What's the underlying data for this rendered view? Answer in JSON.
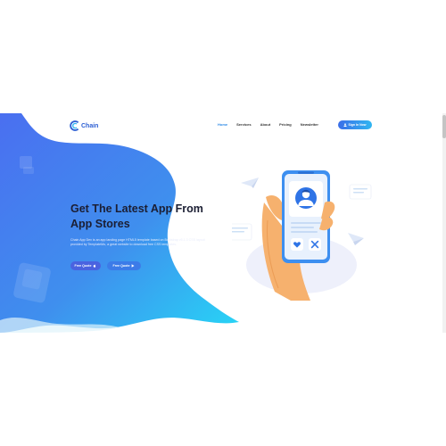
{
  "brand": {
    "name": "Chain"
  },
  "nav": {
    "links": [
      "Home",
      "Services",
      "About",
      "Pricing",
      "Newsletter"
    ],
    "active_index": 0,
    "signin_label": "Sign In Now"
  },
  "hero": {
    "title_line1": "Get The Latest App From",
    "title_line2": "App Stores",
    "description_line1": "Chain App Dev is an app landing page HTML5 template based on Bootstrap v5.1.3 CSS layout",
    "description_line2": "provided by TemplateMo, a great website to download free CSS templates.",
    "button1_label": "Free Quote",
    "button2_label": "Free Quote"
  },
  "colors": {
    "brand_blue": "#2d5fd3",
    "accent": "#2f8be6",
    "gradient_start": "#3b6ee8",
    "gradient_end": "#2fd1f5"
  },
  "icons": {
    "logo": "c-ring-logo",
    "signin": "user-icon",
    "button1": "apple-icon",
    "button2": "play-store-icon",
    "like": "heart-icon",
    "dismiss": "close-icon"
  }
}
